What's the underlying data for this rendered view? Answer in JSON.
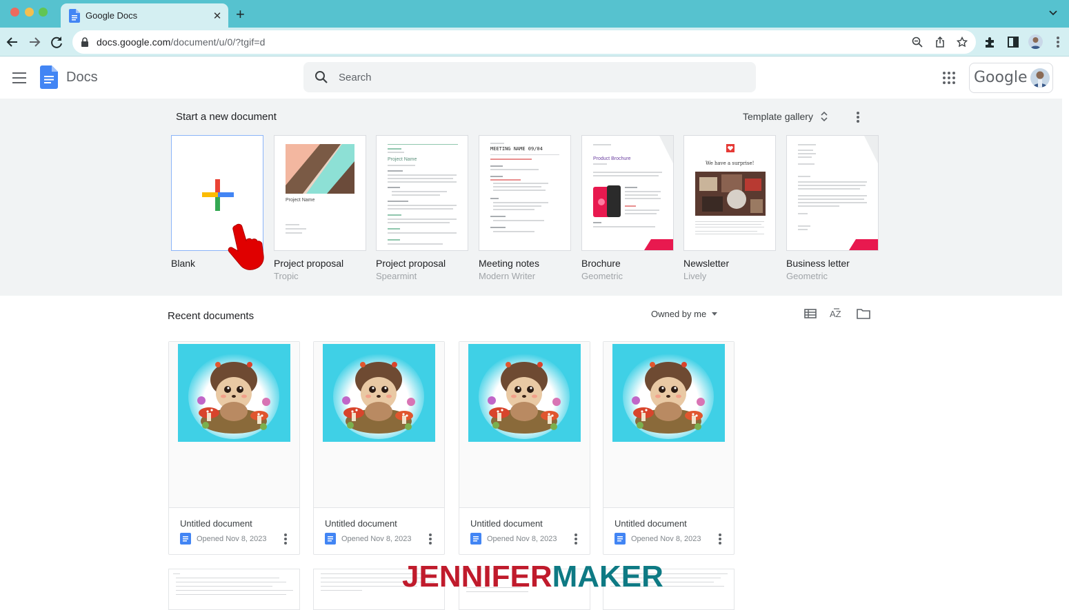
{
  "browser": {
    "tab_title": "Google Docs",
    "url_host": "docs.google.com",
    "url_path": "/document/u/0/?tgif=d"
  },
  "app": {
    "name": "Docs",
    "search_placeholder": "Search",
    "account_word": "Google"
  },
  "templates": {
    "heading": "Start a new document",
    "gallery_label": "Template gallery",
    "items": [
      {
        "name": "Blank",
        "subtitle": ""
      },
      {
        "name": "Project proposal",
        "subtitle": "Tropic"
      },
      {
        "name": "Project proposal",
        "subtitle": "Spearmint"
      },
      {
        "name": "Meeting notes",
        "subtitle": "Modern Writer"
      },
      {
        "name": "Brochure",
        "subtitle": "Geometric"
      },
      {
        "name": "Newsletter",
        "subtitle": "Lively"
      },
      {
        "name": "Business letter",
        "subtitle": "Geometric"
      }
    ],
    "thumb_text": {
      "tropic_project": "Project Name",
      "spearmint_project": "Project Name",
      "meeting": "MEETING NAME 09/04",
      "brochure": "Product Brochure",
      "newsletter": "We have a surprise!"
    }
  },
  "recent": {
    "heading": "Recent documents",
    "owner_filter": "Owned by me",
    "documents": [
      {
        "title": "Untitled document",
        "opened": "Opened Nov 8, 2023"
      },
      {
        "title": "Untitled document",
        "opened": "Opened Nov 8, 2023"
      },
      {
        "title": "Untitled document",
        "opened": "Opened Nov 8, 2023"
      },
      {
        "title": "Untitled document",
        "opened": "Opened Nov 8, 2023"
      }
    ]
  },
  "watermark": {
    "part1": "JENNIFER",
    "part2": "MAKER"
  },
  "colors": {
    "chrome_tabbar": "#56c2cf",
    "chrome_toolbar": "#d4eff2",
    "docs_blue": "#4285f4",
    "template_bg": "#f1f3f4",
    "thumb_cyan": "#3fd0e6",
    "pointer_red": "#e00000"
  },
  "icons": [
    "docs-favicon-icon",
    "back-icon",
    "forward-icon",
    "reload-icon",
    "lock-icon",
    "zoom-icon",
    "share-icon",
    "star-icon",
    "extensions-icon",
    "sidepanel-icon",
    "menu-icon",
    "search-icon",
    "apps-grid-icon",
    "unfold-icon",
    "list-view-icon",
    "sort-az-icon",
    "folder-icon",
    "hand-pointer-icon"
  ]
}
